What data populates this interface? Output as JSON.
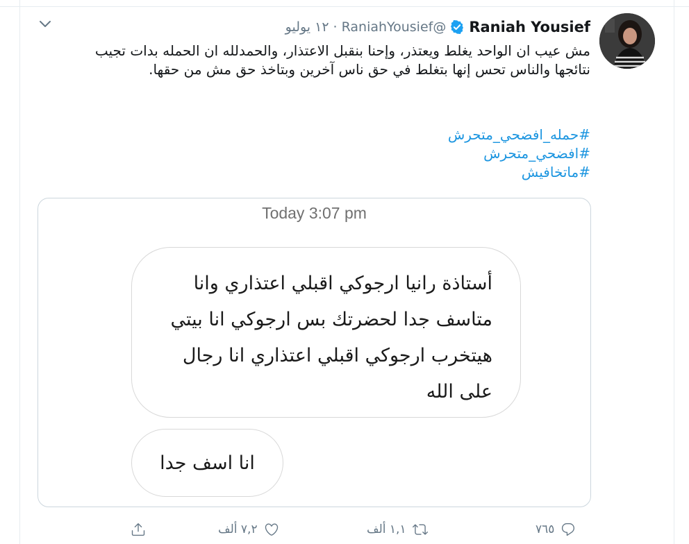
{
  "tweet": {
    "display_name": "Raniah Yousief",
    "handle": "@RaniahYousief",
    "separator": "·",
    "date": "١٢ يوليو",
    "text": "مش عيب ان الواحد يغلط ويعتذر، وإحنا بنقبل الاعتذار، والحمدلله ان الحمله بدات تجيب نتائجها والناس تحس إنها بتغلط في حق ناس آخرين وبتاخذ حق مش من حقها.",
    "hashtags": [
      "#حمله_افضحي_متحرش",
      "#افضحي_متحرش",
      "#ماتخافيش"
    ]
  },
  "media": {
    "timestamp": "Today 3:07 pm",
    "message_1": "أستاذة رانيا ارجوكي اقبلي اعتذاري وانا متاسف جدا لحضرتك بس ارجوكي انا بيتي هيتخرب  ارجوكي اقبلي اعتذاري انا رجال على الله",
    "message_2": "انا اسف جدا"
  },
  "actions": {
    "replies": "٧٦٥",
    "retweets": "١,١ ألف",
    "likes": "٧,٢ ألف"
  },
  "icons": {
    "verified": "verified-badge-icon",
    "menu": "chevron-down-icon",
    "reply": "reply-icon",
    "retweet": "retweet-icon",
    "like": "heart-icon",
    "share": "share-icon"
  },
  "colors": {
    "link": "#1b95e0",
    "muted": "#657786",
    "verified": "#1da1f2"
  }
}
